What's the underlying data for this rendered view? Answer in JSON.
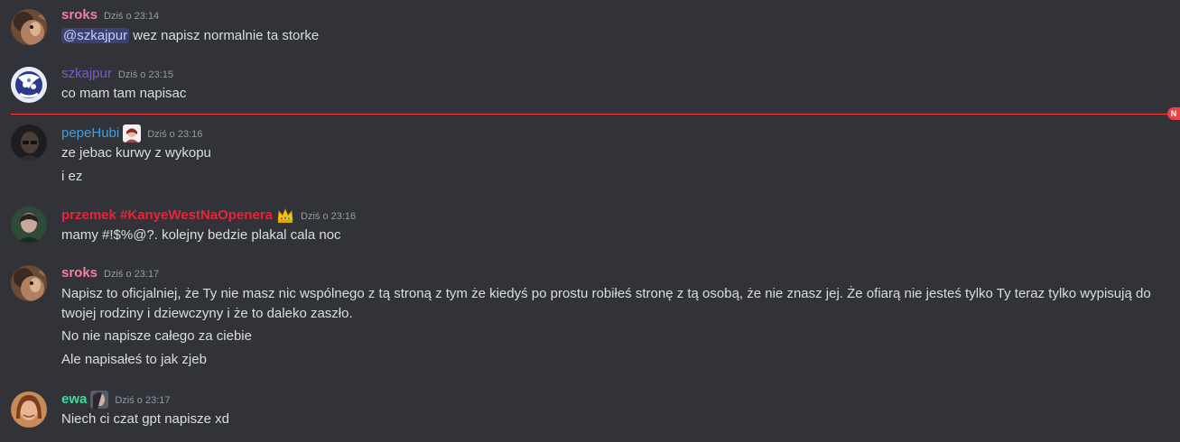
{
  "messages": [
    {
      "username": "sroks",
      "username_color": "#f47fa0",
      "timestamp": "Dziś o 23:14",
      "mention": "@szkajpur",
      "lines": [
        "wez napisz normalnie ta storke"
      ]
    },
    {
      "username": "szkajpur",
      "username_color": "#7a5bc6",
      "timestamp": "Dziś o 23:15",
      "lines": [
        "co mam tam napisac"
      ]
    },
    {
      "username": "pepeHubi",
      "username_color": "#3f9ee0",
      "timestamp": "Dziś o 23:16",
      "lines": [
        "ze jebac kurwy z wykopu",
        "i ez"
      ]
    },
    {
      "username": "przemek #KanyeWestNaOpenera",
      "username_color": "#e8243b",
      "timestamp": "Dziś o 23:16",
      "lines": [
        "mamy #!$%@?. kolejny bedzie plakal cala noc"
      ]
    },
    {
      "username": "sroks",
      "username_color": "#f47fa0",
      "timestamp": "Dziś o 23:17",
      "lines": [
        "Napisz to oficjalniej, że Ty nie masz nic wspólnego z tą stroną z tym że kiedyś po prostu robiłeś stronę z tą osobą, że nie znasz jej. Że ofiarą nie jesteś tylko Ty teraz tylko wypisują do",
        "twojej rodziny i dziewczyny i że to daleko zaszło.",
        "No nie napisze całego za ciebie",
        "Ale napisałeś to jak zjeb"
      ]
    },
    {
      "username": "ewa",
      "username_color": "#3fdca0",
      "timestamp": "Dziś o 23:17",
      "lines": [
        "Niech ci czat gpt napisze xd"
      ]
    }
  ],
  "divider": {
    "label": "N",
    "color": "#f23f43"
  }
}
